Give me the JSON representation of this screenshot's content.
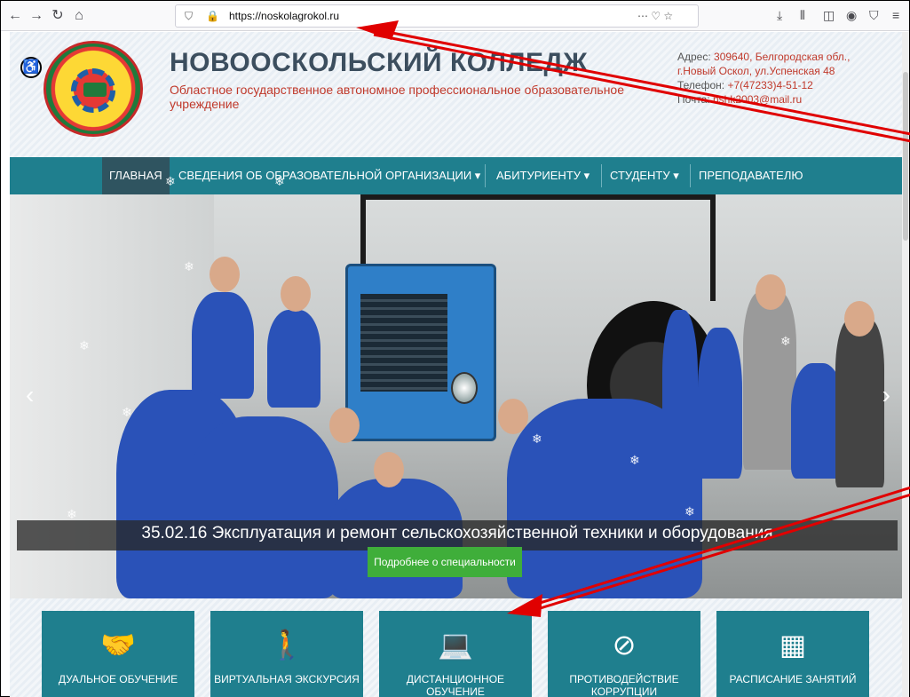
{
  "browser": {
    "url": "https://noskolagrokol.ru",
    "page_actions": "⋯ ♡ ☆"
  },
  "header": {
    "title": "НОВООСКОЛЬСКИЙ КОЛЛЕДЖ",
    "subtitle": "Областное государственное автономное профессиональное образовательное учреждение",
    "address_label": "Адрес: ",
    "address_value": "309640, Белгородская обл., г.Новый Оскол, ул.Успенская 48",
    "phone_label": "Телефон: ",
    "phone_value": "+7(47233)4-51-12",
    "mail_label": "Почта: ",
    "mail_value": "nshk2003@mail.ru"
  },
  "nav": {
    "items": [
      {
        "label": "ГЛАВНАЯ"
      },
      {
        "label": "СВЕДЕНИЯ ОБ ОБРАЗОВАТЕЛЬНОЙ ОРГАНИЗАЦИИ ▾"
      },
      {
        "label": "АБИТУРИЕНТУ ▾"
      },
      {
        "label": "СТУДЕНТУ ▾"
      },
      {
        "label": "ПРЕПОДАВАТЕЛЮ"
      }
    ]
  },
  "slider": {
    "caption": "35.02.16 Эксплуатация и ремонт сельскохозяйственной техники и оборудования",
    "button": "Подробнее о специальности",
    "prev": "‹",
    "next": "›"
  },
  "tiles": [
    {
      "label": "ДУАЛЬНОЕ ОБУЧЕНИЕ",
      "icon": "handshake-icon",
      "glyph": "🤝"
    },
    {
      "label": "ВИРТУАЛЬНАЯ ЭКСКУРСИЯ",
      "icon": "person-icon",
      "glyph": "🚶"
    },
    {
      "label": "ДИСТАНЦИОННОЕ ОБУЧЕНИЕ",
      "icon": "laptop-icon",
      "glyph": "💻"
    },
    {
      "label": "ПРОТИВОДЕЙСТВИЕ КОРРУПЦИИ",
      "icon": "prohibited-icon",
      "glyph": "⊘"
    },
    {
      "label": "РАСПИСАНИЕ ЗАНЯТИЙ",
      "icon": "calendar-grid-icon",
      "glyph": "▦"
    }
  ],
  "colors": {
    "nav_bg": "#1f7f8e",
    "accent_red": "#c0392b",
    "button_green": "#3fae3a",
    "annotation": "#e00000"
  }
}
